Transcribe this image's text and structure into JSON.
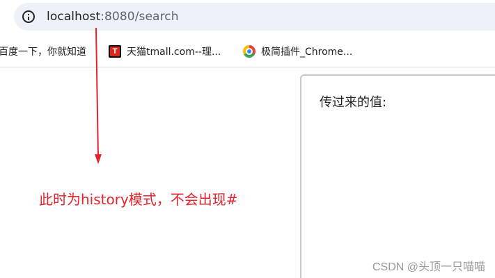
{
  "browser": {
    "address_bar": {
      "url_host": "localhost",
      "url_rest": ":8080/search",
      "info_icon": "info-icon"
    },
    "bookmarks": [
      {
        "label": "百度一下，你就知道",
        "icon": "none"
      },
      {
        "label": "天猫tmall.com--理...",
        "icon": "tmall-icon"
      },
      {
        "label": "极简插件_Chrome...",
        "icon": "chrome-icon"
      }
    ]
  },
  "annotation": {
    "text": "此时为history模式，不会出现#",
    "color": "#e3242b"
  },
  "panel": {
    "label": "传过来的值:"
  },
  "watermark": {
    "text": "CSDN @头顶一只喵喵"
  }
}
